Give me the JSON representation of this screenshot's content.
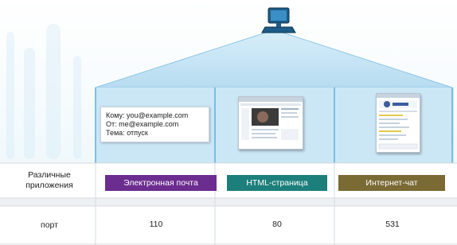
{
  "email": {
    "to": "Кому: you@example.com",
    "from": "От: me@example.com",
    "subject": "Тема: отпуск"
  },
  "rows": {
    "apps_label_line1": "Различные",
    "apps_label_line2": "приложения",
    "port_label": "порт"
  },
  "apps": [
    {
      "label": "Электронная почта",
      "color": "#6b2d8f"
    },
    {
      "label": "HTML-страница",
      "color": "#1d7f7c"
    },
    {
      "label": "Интернет-чат",
      "color": "#7a6a34"
    }
  ],
  "ports": [
    "110",
    "80",
    "531"
  ],
  "colors": {
    "beam": "#bfe2f4",
    "beam_edge": "#5eaedb",
    "row_band": "#eef1f3",
    "grid_line": "#d4dbe1"
  }
}
